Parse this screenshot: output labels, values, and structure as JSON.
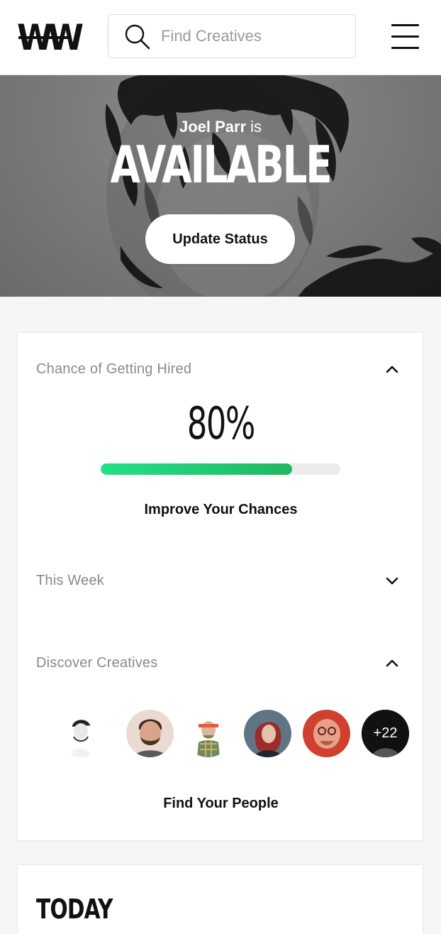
{
  "header": {
    "logo_text": "WW",
    "search": {
      "placeholder": "Find Creatives",
      "icon": "search-icon"
    },
    "menu_icon": "hamburger-menu-icon"
  },
  "hero": {
    "name": "Joel Parr",
    "connector": "is",
    "status": "AVAILABLE",
    "update_button": "Update Status"
  },
  "hire_section": {
    "label": "Chance of Getting Hired",
    "percent_text": "80%",
    "progress": 0.8,
    "link": "Improve Your Chances",
    "expanded": true
  },
  "week_section": {
    "label": "This Week",
    "expanded": false
  },
  "discover_section": {
    "label": "Discover Creatives",
    "expanded": true,
    "more_count": "+22",
    "link": "Find Your People"
  },
  "today": {
    "title": "TODAY"
  },
  "colors": {
    "progress_start": "#22e089",
    "progress_end": "#1fb85f",
    "muted_label": "#8a8a8a"
  }
}
